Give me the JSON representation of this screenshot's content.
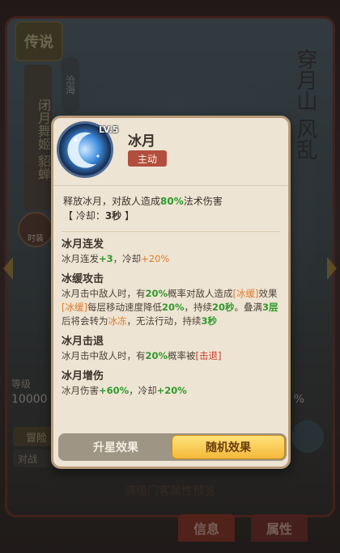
{
  "background": {
    "badge": "传说",
    "hero_title": "闭月舞姬 貂蝉",
    "subtag": "沧海",
    "calligraphy": "穿月山 风乱",
    "portrait_label": "时装",
    "stat_label": "等级",
    "stat_value": "10000",
    "stat_right": "%",
    "adventure_button": "冒险",
    "field_text": "对战",
    "footer_text": "满级门客属性预览",
    "tabs": {
      "info": "信息",
      "attributes": "属性"
    }
  },
  "popup": {
    "skill": {
      "level": "LV.5",
      "name": "冰月",
      "type": "主动",
      "description": {
        "prefix": "释放冰月，对敌人造成",
        "percent": "80%",
        "suffix": "法术伤害"
      },
      "cooldown": {
        "open": "【 冷却：",
        "value": "3秒",
        "close": " 】"
      }
    },
    "effects": [
      {
        "title": "冰月连发",
        "text_a": "冰月连发",
        "value_a": "+3",
        "text_b": "，冷却",
        "value_b": "+20%"
      },
      {
        "title": "冰缓攻击",
        "line1_a": "冰月击中敌人时，有",
        "line1_pct": "20%",
        "line1_b": "概率对敌人造成",
        "tag1": "[冰缓]",
        "line1_c": "效果",
        "tag2": "[冰缓]",
        "line2_a": "每层移动速度降低",
        "line2_pct": "20%",
        "line2_b": "，持续",
        "line2_dur": "20秒",
        "line2_c": "。叠满",
        "line2_layers": "3层",
        "line2_d": "后将会转为",
        "line2_freeze": "冰冻",
        "line2_e": "，无法行动，持续",
        "line2_dur2": "3秒"
      },
      {
        "title": "冰月击退",
        "text_a": "冰月击中敌人时，有",
        "pct": "20%",
        "text_b": "概率被",
        "tag": "[击退]"
      },
      {
        "title": "冰月增伤",
        "text_a": "冰月伤害",
        "value_a": "+60%",
        "text_b": "，冷却",
        "value_b": "+20%"
      }
    ],
    "tabs": {
      "upgrade": "升星效果",
      "random": "随机效果",
      "active": "random"
    }
  },
  "colors": {
    "highlight_green": "#2e9a2c",
    "highlight_orange": "#e07a2a",
    "highlight_red": "#cc3a2a",
    "active_tab": "#f5b93a",
    "type_badge": "#b24e3e"
  },
  "icons": {
    "skill_icon": "crescent-moon-icon",
    "arrow_left": "chevron-left-icon",
    "arrow_right": "chevron-right-icon"
  }
}
